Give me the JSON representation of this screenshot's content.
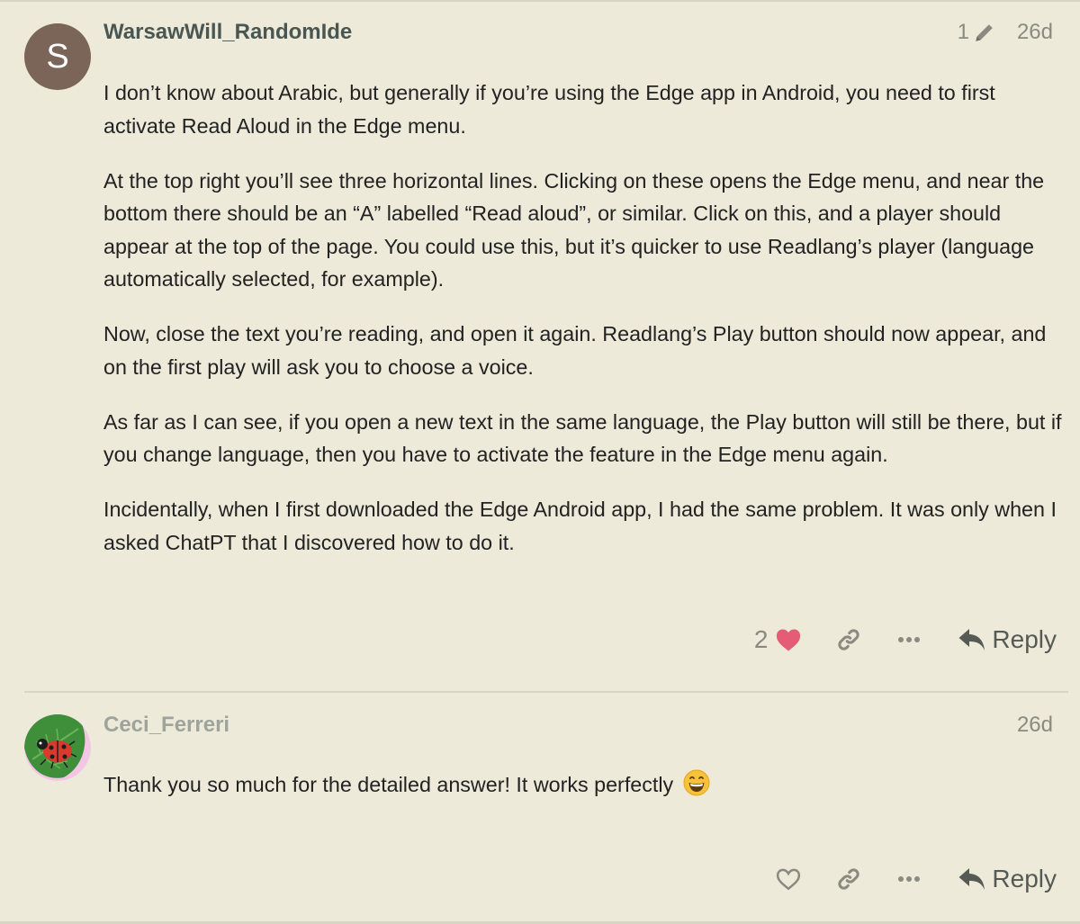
{
  "posts": [
    {
      "author": "WarsawWill_RandomIde",
      "avatar_letter": "S",
      "edit_count": "1",
      "age": "26d",
      "paragraphs": [
        "I don’t know about Arabic, but generally if you’re using the Edge app in Android, you need to first activate Read Aloud in the Edge menu.",
        "At the top right you’ll see three horizontal lines. Clicking on these opens the Edge menu, and near the bottom there should be an “A” labelled “Read aloud”, or similar. Click on this, and a player should appear at the top of the page. You could use this, but it’s quicker to use Readlang’s player (language automatically selected, for example).",
        "Now, close the text you’re reading, and open it again. Readlang’s Play button should now appear, and on the first play will ask you to choose a voice.",
        "As far as I can see, if you open a new text in the same language, the Play button will still be there, but if you change language, then you have to activate the feature in the Edge menu again.",
        "Incidentally, when I first downloaded the Edge Android app, I had the same problem. It was only when I asked ChatPT that I discovered how to do it."
      ],
      "like_count": "2",
      "reply_label": "Reply",
      "icons": {
        "edit": "pencil-icon",
        "like": "heart-filled-icon",
        "link": "link-icon",
        "more": "ellipsis-icon",
        "reply": "reply-arrow-icon"
      },
      "colors": {
        "avatar_bg": "#7B6559",
        "heart": "#E45C75",
        "author": "#4A5652"
      }
    },
    {
      "author": "Ceci_Ferreri",
      "age": "26d",
      "paragraphs": [
        "Thank you so much for the detailed answer! It works perfectly"
      ],
      "emoji": "grinning-face-emoji",
      "reply_label": "Reply",
      "icons": {
        "like": "heart-outline-icon",
        "link": "link-icon",
        "more": "ellipsis-icon",
        "reply": "reply-arrow-icon",
        "avatar": "ladybug-on-leaf-avatar"
      },
      "colors": {
        "author": "#9EA39B"
      }
    }
  ]
}
